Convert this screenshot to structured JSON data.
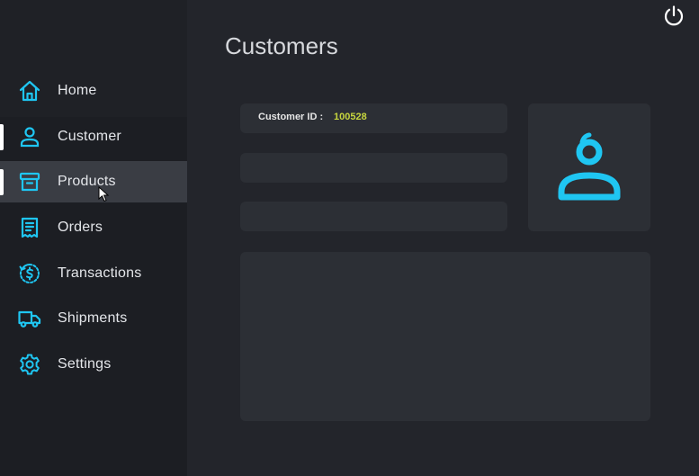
{
  "sidebar": {
    "items": [
      {
        "label": "Home"
      },
      {
        "label": "Customer"
      },
      {
        "label": "Products"
      },
      {
        "label": "Orders"
      },
      {
        "label": "Transactions"
      },
      {
        "label": "Shipments"
      },
      {
        "label": "Settings"
      }
    ],
    "active_item": "Customer",
    "hovered_item": "Products"
  },
  "header": {
    "title": "Customers"
  },
  "customer_form": {
    "id_label": "Customer ID :",
    "id_value": "100528",
    "field_2_value": "",
    "field_3_value": "",
    "notes_value": ""
  },
  "icons": {
    "power": "power-icon",
    "avatar": "user-avatar-icon"
  },
  "colors": {
    "accent": "#1fc6f2",
    "id_value": "#c7d63e",
    "background": "#23252b",
    "sidebar": "#1c1e23",
    "card": "#2c2f35"
  }
}
